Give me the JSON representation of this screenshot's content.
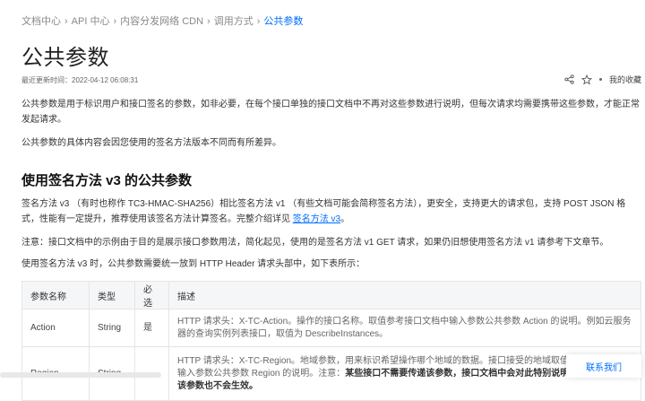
{
  "breadcrumb": {
    "items": [
      "文档中心",
      "API 中心",
      "内容分发网络 CDN",
      "调用方式"
    ],
    "current": "公共参数",
    "separator": "›"
  },
  "page": {
    "title": "公共参数",
    "updated": "最近更新时间：2022-04-12 06:08:31",
    "favorites_label": "我的收藏"
  },
  "intro": {
    "p1": "公共参数是用于标识用户和接口签名的参数，如非必要，在每个接口单独的接口文档中不再对这些参数进行说明，但每次请求均需要携带这些参数，才能正常发起请求。",
    "p2": "公共参数的具体内容会因您使用的签名方法版本不同而有所差异。"
  },
  "section": {
    "heading": "使用签名方法 v3 的公共参数",
    "p1_text": "签名方法 v3 （有时也称作 TC3-HMAC-SHA256）相比签名方法 v1 （有些文档可能会简称签名方法），更安全，支持更大的请求包，支持 POST JSON 格式，性能有一定提升，推荐使用该签名方法计算签名。完整介绍详见 ",
    "p1_link": "签名方法 v3",
    "p1_end": "。",
    "note": "注意：接口文档中的示例由于目的是展示接口参数用法，简化起见，使用的是签名方法 v1 GET 请求，如果仍旧想使用签名方法 v1 请参考下文章节。",
    "p3": "使用签名方法 v3 时，公共参数需要统一放到 HTTP Header 请求头部中，如下表所示："
  },
  "table": {
    "headers": [
      "参数名称",
      "类型",
      "必选",
      "描述"
    ],
    "rows": [
      {
        "name": "Action",
        "type": "String",
        "required": "是",
        "desc": "HTTP 请求头：X-TC-Action。操作的接口名称。取值参考接口文档中输入参数公共参数 Action 的说明。例如云服务器的查询实例列表接口，取值为 DescribeInstances。"
      },
      {
        "name": "Region",
        "type": "String",
        "required": "-",
        "desc_a": "HTTP 请求头：X-TC-Region。地域参数，用来标识希望操作哪个地域的数据。接口接受的地域取值参考接口文档中输入参数公共参数 Region 的说明。注意：",
        "desc_bold": "某些接口不需要传递该参数，接口文档中会对此特别说明，此时即使传递该参数也不会生效。",
        "desc_b": ""
      }
    ]
  },
  "contact_label": "联系我们",
  "colors": {
    "accent": "#006eff",
    "text": "#333333",
    "header_bg": "#f5f6f8"
  }
}
